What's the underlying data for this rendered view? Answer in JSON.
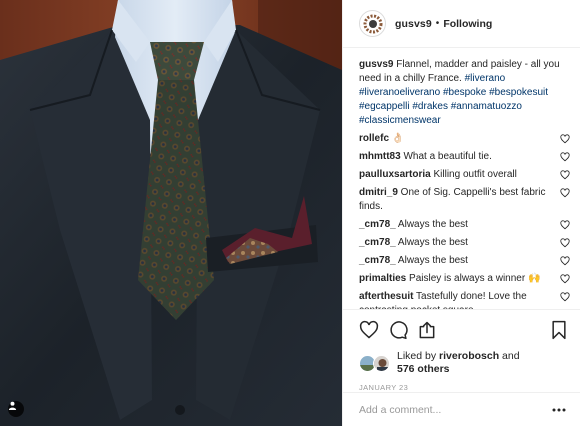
{
  "colors": {
    "link": "#003569",
    "muted": "#999999",
    "text": "#262626",
    "border": "#efefef"
  },
  "post": {
    "image_alt_subject": "navy flannel suit with paisley pocket square",
    "tag_icon": "person-tag-icon"
  },
  "header": {
    "username": "gusvs9",
    "separator": "•",
    "follow_label": "Following"
  },
  "caption": {
    "username": "gusvs9",
    "text": " Flannel, madder and paisley - all you need in a chilly France. ",
    "hashtags": "#liverano #liveranoeliverano #bespoke #bespokesuit #egcappelli #drakes #annamatuozzo #classicmenswear"
  },
  "comments": [
    {
      "user": "rollefc",
      "text": " 👌🏻"
    },
    {
      "user": "mhmtt83",
      "text": " What a beautiful tie."
    },
    {
      "user": "paulluxsartoria",
      "text": " Killing outfit overall"
    },
    {
      "user": "dmitri_9",
      "text": " One of Sig. Cappelli's best fabric finds."
    },
    {
      "user": "_cm78_",
      "text": " Always the best"
    },
    {
      "user": "_cm78_",
      "text": " Always the best"
    },
    {
      "user": "_cm78_",
      "text": " Always the best"
    },
    {
      "user": "primalties",
      "text": " Paisley is always a winner 🙌"
    },
    {
      "user": "afterthesuit",
      "text": " Tastefully done! Love the contrasting pocket square"
    }
  ],
  "actions": {
    "like": "heart-icon",
    "comment": "comment-icon",
    "share": "share-icon",
    "save": "bookmark-icon"
  },
  "likes": {
    "prefix": "Liked by ",
    "user": "riverobosch",
    "middle": " and",
    "count": "576 others"
  },
  "date": "JANUARY 23",
  "add_comment": {
    "placeholder": "Add a comment..."
  }
}
